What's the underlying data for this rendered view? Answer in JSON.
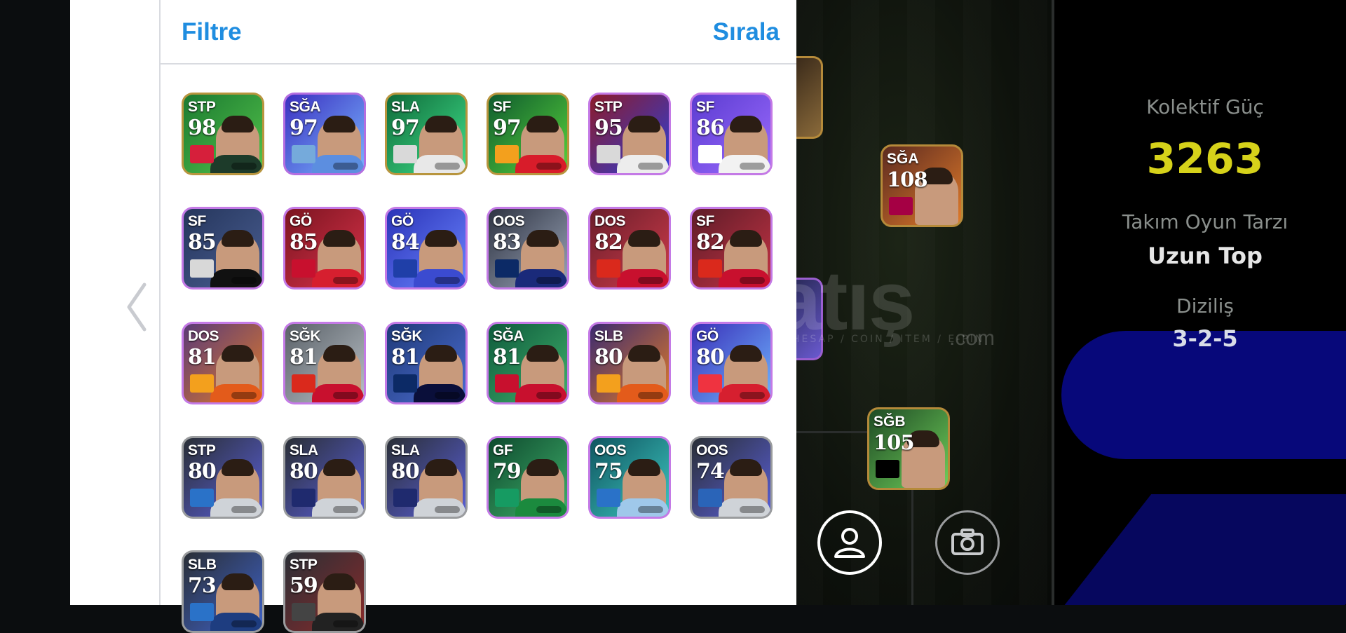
{
  "header": {
    "filter_label": "Filtre",
    "sort_label": "Sırala"
  },
  "nav": {
    "back_icon": "chevron-left-icon"
  },
  "cards": [
    {
      "pos": "STP",
      "rating": "98",
      "frame": "#b8953e",
      "bg": "#1b7a31",
      "bg2": "#53c24a",
      "shirt": "#1d3b2a",
      "flag": "#d61f3b"
    },
    {
      "pos": "SĞA",
      "rating": "97",
      "frame": "#b46ee0",
      "bg": "#3b2fc0",
      "bg2": "#79b6ff",
      "shirt": "#5c8ee0",
      "flag": "#75aadb"
    },
    {
      "pos": "SLA",
      "rating": "97",
      "frame": "#b8953e",
      "bg": "#0f6b3a",
      "bg2": "#3fe08a",
      "shirt": "#e8e8e8",
      "flag": "#d9d9d9"
    },
    {
      "pos": "SF",
      "rating": "97",
      "frame": "#b8953e",
      "bg": "#0f5b2e",
      "bg2": "#57d33b",
      "shirt": "#d81c2a",
      "flag": "#f3a01d"
    },
    {
      "pos": "STP",
      "rating": "95",
      "frame": "#c47ae6",
      "bg": "#8d1b2a",
      "bg2": "#2b3fd8",
      "shirt": "#ededed",
      "flag": "#d9d9d9"
    },
    {
      "pos": "SF",
      "rating": "86",
      "frame": "#c47ae6",
      "bg": "#5b3cd0",
      "bg2": "#9c6bff",
      "shirt": "#f2f2f2",
      "flag": "#ffffff"
    },
    {
      "pos": "SF",
      "rating": "85",
      "frame": "#c47ae6",
      "bg": "#25365c",
      "bg2": "#4a5e92",
      "shirt": "#111111",
      "flag": "#d8d8d8"
    },
    {
      "pos": "GÖ",
      "rating": "85",
      "frame": "#c47ae6",
      "bg": "#7b1420",
      "bg2": "#d9334a",
      "shirt": "#d61f2f",
      "flag": "#c8102e"
    },
    {
      "pos": "GÖ",
      "rating": "84",
      "frame": "#c47ae6",
      "bg": "#2b34b8",
      "bg2": "#6a84ff",
      "shirt": "#3b4bd0",
      "flag": "#1f3fa8"
    },
    {
      "pos": "OOS",
      "rating": "83",
      "frame": "#c47ae6",
      "bg": "#2e3342",
      "bg2": "#9aa5b8",
      "shirt": "#1a2a7a",
      "flag": "#0c2a66"
    },
    {
      "pos": "DOS",
      "rating": "82",
      "frame": "#c47ae6",
      "bg": "#6a1e2a",
      "bg2": "#cf3b4b",
      "shirt": "#c8102e",
      "flag": "#da291c"
    },
    {
      "pos": "SF",
      "rating": "82",
      "frame": "#c47ae6",
      "bg": "#5e1c28",
      "bg2": "#c33344",
      "shirt": "#c8102e",
      "flag": "#da291c"
    },
    {
      "pos": "DOS",
      "rating": "81",
      "frame": "#c47ae6",
      "bg": "#5a3a78",
      "bg2": "#e07b2a",
      "shirt": "#e35b1b",
      "flag": "#f3a01d"
    },
    {
      "pos": "SĞK",
      "rating": "81",
      "frame": "#c47ae6",
      "bg": "#5a6168",
      "bg2": "#b9c0c6",
      "shirt": "#c8102e",
      "flag": "#da291c"
    },
    {
      "pos": "SĞK",
      "rating": "81",
      "frame": "#c47ae6",
      "bg": "#1e3a78",
      "bg2": "#4c6cd0",
      "shirt": "#0a0f3a",
      "flag": "#0c2a66"
    },
    {
      "pos": "SĞA",
      "rating": "81",
      "frame": "#c47ae6",
      "bg": "#0e5a3c",
      "bg2": "#3fb06b",
      "shirt": "#c8102e",
      "flag": "#c8102e"
    },
    {
      "pos": "SLB",
      "rating": "80",
      "frame": "#c47ae6",
      "bg": "#3b2a70",
      "bg2": "#e07b2a",
      "shirt": "#e35b1b",
      "flag": "#f3a01d"
    },
    {
      "pos": "GÖ",
      "rating": "80",
      "frame": "#c47ae6",
      "bg": "#3a2fb8",
      "bg2": "#6fb5ff",
      "shirt": "#d61f2f",
      "flag": "#ef3340"
    },
    {
      "pos": "STP",
      "rating": "80",
      "frame": "#9a9c9e",
      "bg": "#2a2f36",
      "bg2": "#5a5fd8",
      "shirt": "#cfd3d8",
      "flag": "#2a72c8"
    },
    {
      "pos": "SLA",
      "rating": "80",
      "frame": "#9a9c9e",
      "bg": "#2a2f36",
      "bg2": "#5a5fd8",
      "shirt": "#cfd3d8",
      "flag": "#1f2a6e"
    },
    {
      "pos": "SLA",
      "rating": "80",
      "frame": "#9a9c9e",
      "bg": "#2a2f36",
      "bg2": "#5a5fd8",
      "shirt": "#cfd3d8",
      "flag": "#1f2a6e"
    },
    {
      "pos": "GF",
      "rating": "79",
      "frame": "#c47ae6",
      "bg": "#0e4a2e",
      "bg2": "#3fb06b",
      "shirt": "#1b8a3e",
      "flag": "#169b62"
    },
    {
      "pos": "OOS",
      "rating": "75",
      "frame": "#c47ae6",
      "bg": "#0f5560",
      "bg2": "#3dc7c0",
      "shirt": "#9fc8ea",
      "flag": "#2a72c8"
    },
    {
      "pos": "OOS",
      "rating": "74",
      "frame": "#9a9c9e",
      "bg": "#2a2f36",
      "bg2": "#5a5fd8",
      "shirt": "#cfd3d8",
      "flag": "#2a64b8"
    },
    {
      "pos": "SLB",
      "rating": "73",
      "frame": "#9a9c9e",
      "bg": "#2a2f36",
      "bg2": "#3f62c8",
      "shirt": "#1e3d80",
      "flag": "#2a72c8"
    },
    {
      "pos": "STP",
      "rating": "59",
      "frame": "#9a9c9e",
      "bg": "#2a2f36",
      "bg2": "#8a2a2a",
      "shirt": "#222222",
      "flag": "#444444"
    }
  ],
  "field_cards": [
    {
      "pos": "SĞA",
      "rating": "108",
      "bg": "#5c2a20",
      "bg2": "#e07b2a",
      "flag": "#a50044"
    },
    {
      "pos": "SĞB",
      "rating": "105",
      "bg": "#1e4a24",
      "bg2": "#6fcf5a",
      "flag": "#000000"
    }
  ],
  "stats": {
    "collective_label": "Kolektif Güç",
    "collective_value": "3263",
    "style_label": "Takım Oyun Tarzı",
    "style_value": "Uzun Top",
    "formation_label": "Diziliş",
    "formation_value": "3-2-5"
  },
  "watermark": {
    "text": "satış",
    "sub": "HESAP / COIN / ITEM / E-PIN",
    "com": ".com"
  },
  "buttons": {
    "profile_icon": "user-icon",
    "camera_icon": "camera-icon"
  }
}
